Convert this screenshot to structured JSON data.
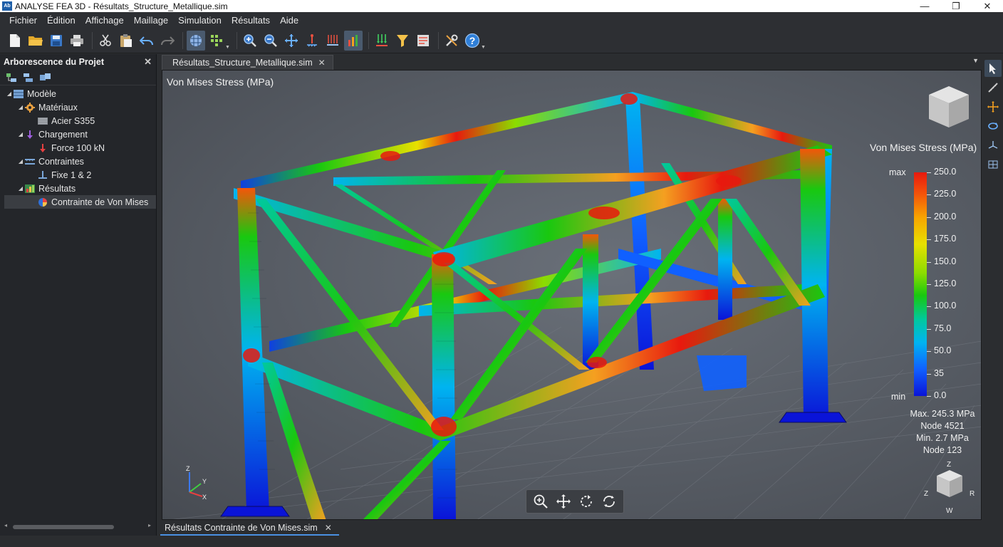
{
  "window": {
    "app_icon": "Ab",
    "title": "ANALYSE FEA 3D - Résultats_Structure_Metallique.sim",
    "minimize": "—",
    "maximize": "❐",
    "close": "✕"
  },
  "menu": [
    "Fichier",
    "Édition",
    "Affichage",
    "Maillage",
    "Simulation",
    "Résultats",
    "Aide"
  ],
  "toolbar_icons": [
    "new-file-icon",
    "open-folder-icon",
    "save-icon",
    "print-icon",
    "cut-icon",
    "paste-icon",
    "undo-icon",
    "redo-icon",
    "mesh-icon",
    "mesh-settings-icon",
    "zoom-in-icon",
    "zoom-out-icon",
    "pan-icon",
    "constraint-icon",
    "load-icon",
    "results-icon",
    "apply-force-icon",
    "filter-icon",
    "report-icon",
    "tools-icon",
    "help-icon"
  ],
  "left_panel": {
    "title": "Arborescence du Projet",
    "close": "✕",
    "tree": [
      {
        "label": "Modèle",
        "level": 0,
        "icon": "model-icon",
        "expanded": true
      },
      {
        "label": "Matériaux",
        "level": 1,
        "icon": "materials-icon",
        "expanded": true
      },
      {
        "label": "Acier S355",
        "level": 2,
        "icon": "steel-material-icon"
      },
      {
        "label": "Chargement",
        "level": 1,
        "icon": "load-arrow-icon",
        "expanded": true
      },
      {
        "label": "Force 100 kN",
        "level": 2,
        "icon": "force-icon"
      },
      {
        "label": "Contraintes",
        "level": 1,
        "icon": "constraints-icon",
        "expanded": true
      },
      {
        "label": "Fixe 1 & 2",
        "level": 2,
        "icon": "fixed-support-icon"
      },
      {
        "label": "Résultats",
        "level": 1,
        "icon": "results-folder-icon",
        "expanded": true
      },
      {
        "label": "Contrainte de Von Mises",
        "level": 2,
        "icon": "von-mises-result-icon",
        "selected": true
      }
    ]
  },
  "document_tab": {
    "label": "Résultats_Structure_Metallique.sim",
    "close": "✕"
  },
  "viewport": {
    "title": "Von Mises Stress (MPa)",
    "legend": {
      "title": "Von Mises Stress (MPa)",
      "max_label": "max",
      "min_label": "min",
      "values": [
        "250.0",
        "225.0",
        "200.0",
        "175.0",
        "150.0",
        "125.0",
        "100.0",
        "75.0",
        "50.0",
        "35",
        "0.0"
      ]
    },
    "stats": [
      "Max. 245.3 MPa",
      "Node 4521",
      "Min. 2.7 MPa",
      "Node 123"
    ],
    "axis_labels": {
      "z": "Z",
      "y": "Y",
      "x": "X"
    },
    "nav_cube_labels": {
      "top": "Z",
      "left": "Z",
      "right": "R",
      "bottom": "W"
    },
    "colors": {
      "high": "#e8190e",
      "mid": "#19c80f",
      "low": "#0a14d8"
    }
  },
  "bottom_tab": {
    "label": "Résultats Contrainte de Von Mises.sim",
    "close": "✕"
  }
}
